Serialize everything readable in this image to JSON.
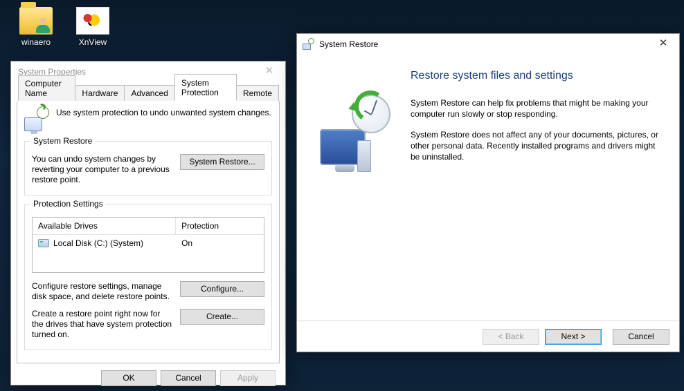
{
  "desktop": {
    "icons": [
      {
        "label": "winaero"
      },
      {
        "label": "XnView"
      }
    ]
  },
  "sysprop": {
    "title": "System Properties",
    "tabs": [
      "Computer Name",
      "Hardware",
      "Advanced",
      "System Protection",
      "Remote"
    ],
    "active_tab_index": 3,
    "intro": "Use system protection to undo unwanted system changes.",
    "restore_section": {
      "legend": "System Restore",
      "text": "You can undo system changes by reverting your computer to a previous restore point.",
      "button": "System Restore..."
    },
    "protection_section": {
      "legend": "Protection Settings",
      "columns": [
        "Available Drives",
        "Protection"
      ],
      "rows": [
        {
          "drive": "Local Disk (C:) (System)",
          "status": "On"
        }
      ],
      "configure_text": "Configure restore settings, manage disk space, and delete restore points.",
      "configure_button": "Configure...",
      "create_text": "Create a restore point right now for the drives that have system protection turned on.",
      "create_button": "Create..."
    },
    "buttons": {
      "ok": "OK",
      "cancel": "Cancel",
      "apply": "Apply"
    }
  },
  "restore": {
    "title": "System Restore",
    "heading": "Restore system files and settings",
    "para1": "System Restore can help fix problems that might be making your computer run slowly or stop responding.",
    "para2": "System Restore does not affect any of your documents, pictures, or other personal data. Recently installed programs and drivers might be uninstalled.",
    "buttons": {
      "back": "< Back",
      "next": "Next >",
      "cancel": "Cancel"
    }
  }
}
